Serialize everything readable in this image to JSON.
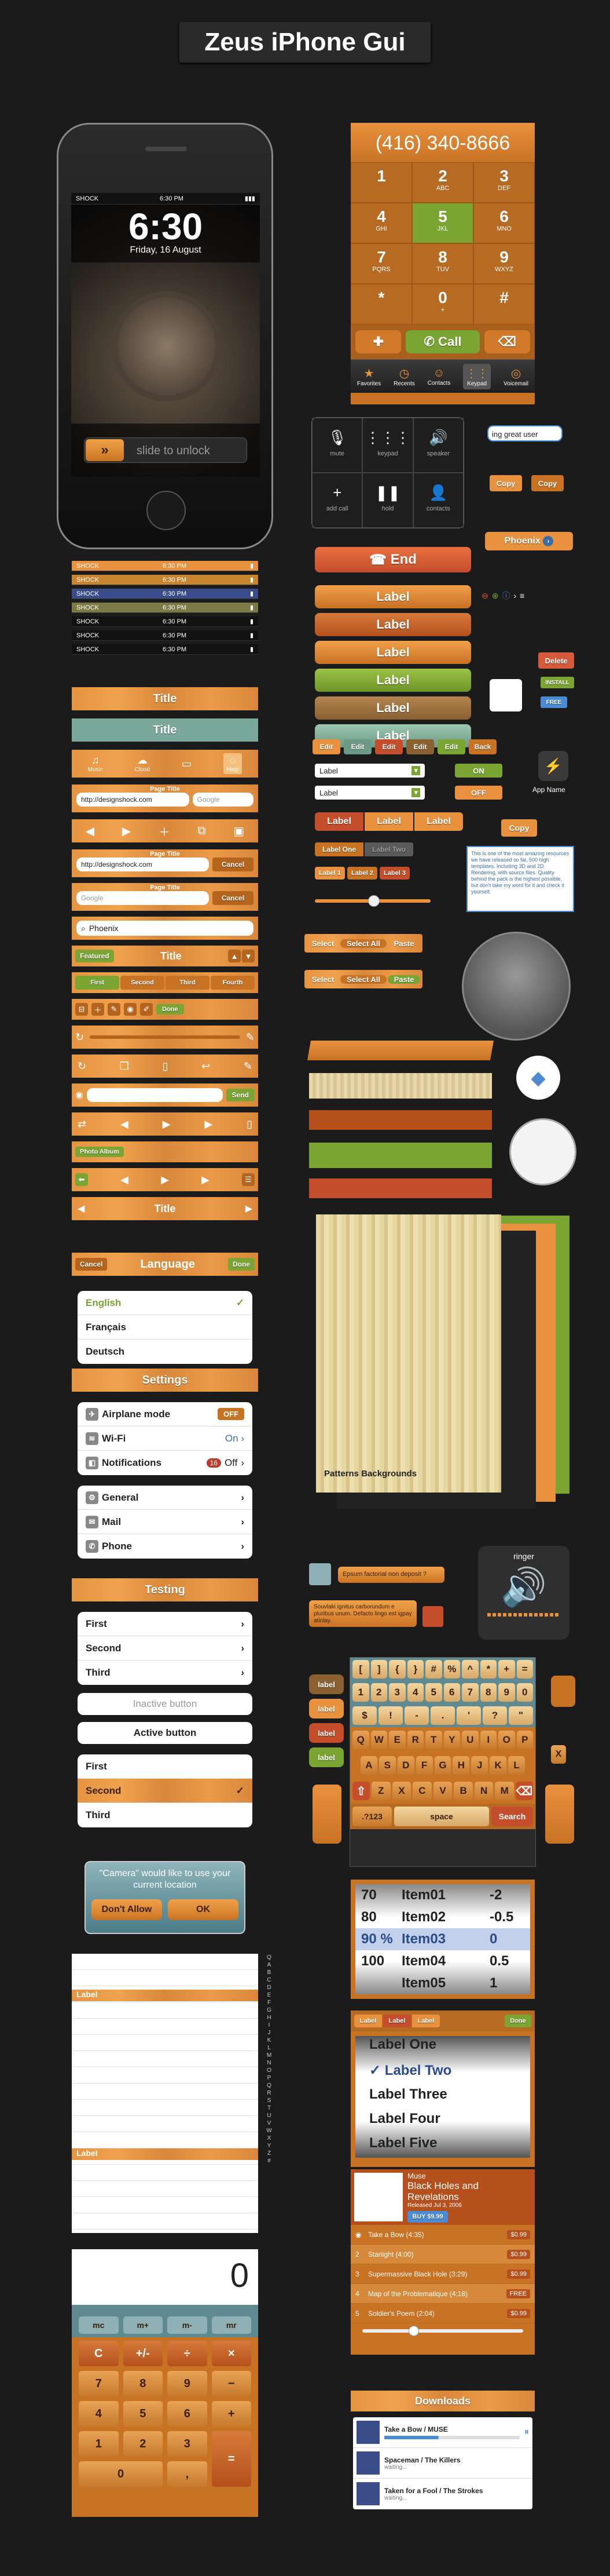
{
  "header": {
    "title": "Zeus iPhone Gui"
  },
  "phone": {
    "carrier": "SHOCK",
    "status_time": "6:30 PM",
    "time": "6:30",
    "date": "Friday, 16 August",
    "unlock": "slide to unlock"
  },
  "status_bars": [
    {
      "carrier": "SHOCK",
      "time": "6:30 PM"
    },
    {
      "carrier": "SHOCK",
      "time": "6:30 PM"
    },
    {
      "carrier": "SHOCK",
      "time": "6:30 PM"
    },
    {
      "carrier": "SHOCK",
      "time": "6:30 PM"
    },
    {
      "carrier": "SHOCK",
      "time": "6:30 PM"
    },
    {
      "carrier": "SHOCK",
      "time": "6:30 PM"
    },
    {
      "carrier": "SHOCK",
      "time": "6:30 PM"
    }
  ],
  "dialer": {
    "number": "(416) 340-8666",
    "keys": [
      {
        "n": "1",
        "l": ""
      },
      {
        "n": "2",
        "l": "ABC"
      },
      {
        "n": "3",
        "l": "DEF"
      },
      {
        "n": "4",
        "l": "GHI"
      },
      {
        "n": "5",
        "l": "JKL"
      },
      {
        "n": "6",
        "l": "MNO"
      },
      {
        "n": "7",
        "l": "PQRS"
      },
      {
        "n": "8",
        "l": "TUV"
      },
      {
        "n": "9",
        "l": "WXYZ"
      },
      {
        "n": "*",
        "l": ""
      },
      {
        "n": "0",
        "l": "+"
      },
      {
        "n": "#",
        "l": ""
      }
    ],
    "call": "Call",
    "tabs": [
      "Favorites",
      "Recents",
      "Contacts",
      "Keypad",
      "Voicemail"
    ]
  },
  "incall": {
    "buttons": [
      "mute",
      "keypad",
      "speaker",
      "add call",
      "hold",
      "contacts"
    ],
    "end": "End"
  },
  "tooltips": {
    "search": "ing great user",
    "copy1": "Copy",
    "copy2": "Copy",
    "bubble": "Phoenix"
  },
  "labels": [
    "Label",
    "Label",
    "Label",
    "Label",
    "Label",
    "Label"
  ],
  "small_buttons": {
    "edit": [
      "Edit",
      "Edit",
      "Edit",
      "Edit",
      "Edit"
    ],
    "back": "Back",
    "delete": "Delete",
    "install": "INSTALL",
    "free": "FREE",
    "on": "ON",
    "off": "OFF",
    "app_name": "App Name",
    "copy": "Copy",
    "label_one": "Label One",
    "label_two": "Label Two",
    "label_1": "Label 1",
    "label_2": "Label 2",
    "label_3": "Label 3"
  },
  "select_labels": [
    "Label",
    "Label"
  ],
  "segmented": [
    "Label",
    "Label",
    "Label"
  ],
  "lorem": "This is one of the most amazing resources we have released so far, 500 high templates. Including 3D and 2D Rendering, with source files. Quality behind the pack is the highest possible, but don't take my word for it and check it yourself.",
  "menus": {
    "first": [
      "Select",
      "Select All",
      "Paste"
    ],
    "second": [
      "Select",
      "Select All",
      "Paste"
    ]
  },
  "bars": {
    "title1": "Title",
    "title2": "Title",
    "tab_labels": [
      "Music",
      "Cloud",
      "",
      "Help"
    ],
    "page_title1": "Page Title",
    "url1": "http://designshock.com",
    "search_ph": "Google",
    "page_title2": "Page Title",
    "url2": "http://designshock.com",
    "cancel": "Cancel",
    "page_title3": "Page Title",
    "google": "Google",
    "cancel2": "Cancel",
    "search_val": "Phoenix",
    "featured": "Featured",
    "title3": "Title",
    "seg": [
      "First",
      "Second",
      "Third",
      "Fourth"
    ],
    "done": "Done",
    "send": "Send",
    "photo_album": "Photo Album",
    "title4": "Title"
  },
  "language": {
    "cancel": "Cancel",
    "title": "Language",
    "done": "Done",
    "items": [
      "English",
      "Français",
      "Deutsch"
    ]
  },
  "settings": {
    "title": "Settings",
    "group1": [
      {
        "label": "Airplane mode",
        "value": "OFF"
      },
      {
        "label": "Wi-Fi",
        "value": "On"
      },
      {
        "label": "Notifications",
        "value": "Off",
        "badge": "16"
      }
    ],
    "group2": [
      "General",
      "Mail",
      "Phone"
    ]
  },
  "testing": {
    "title": "Testing",
    "list1": [
      "First",
      "Second",
      "Third"
    ],
    "inactive": "Inactive button",
    "active": "Active button",
    "list2": [
      "First",
      "Second",
      "Third"
    ]
  },
  "alert": {
    "message": "\"Camera\" would like to use your current location",
    "dont": "Don't Allow",
    "ok": "OK"
  },
  "indexed": {
    "label1": "Label",
    "label2": "Label",
    "letters": [
      "Q",
      "A",
      "B",
      "C",
      "D",
      "E",
      "F",
      "G",
      "H",
      "I",
      "J",
      "K",
      "L",
      "M",
      "N",
      "O",
      "P",
      "Q",
      "R",
      "S",
      "T",
      "U",
      "V",
      "W",
      "X",
      "Y",
      "Z",
      "#"
    ]
  },
  "calculator": {
    "display": "0",
    "mem": [
      "mc",
      "m+",
      "m-",
      "mr"
    ],
    "rows": [
      [
        "C",
        "+/-",
        "÷",
        "×"
      ],
      [
        "7",
        "8",
        "9",
        "−"
      ],
      [
        "4",
        "5",
        "6",
        "+"
      ],
      [
        "1",
        "2",
        "3",
        "="
      ],
      [
        "0",
        ",",
        "",
        ""
      ]
    ]
  },
  "patterns": {
    "label": "Patterns Backgrounds"
  },
  "chat": {
    "bubble1": "Epsum factorial non deposit ?",
    "bubble2": "Souvlaki ignitus carborundum e pluribus unum. Defacto lingo est igpay atinlay."
  },
  "ringer": {
    "title": "ringer"
  },
  "keyboard": {
    "labels": [
      "label",
      "label",
      "label",
      "label"
    ],
    "row1": [
      "[",
      "]",
      "{",
      "}",
      "#",
      "%",
      "^",
      "*",
      "+",
      "="
    ],
    "row2": [
      "1",
      "2",
      "3",
      "4",
      "5",
      "6",
      "7",
      "8",
      "9",
      "0"
    ],
    "row3": [
      "$",
      "!",
      "-",
      ".",
      "'",
      "?",
      "\""
    ],
    "row4": [
      "Q",
      "W",
      "E",
      "R",
      "T",
      "Y",
      "U",
      "I",
      "O",
      "P"
    ],
    "row5": [
      "A",
      "S",
      "D",
      "F",
      "G",
      "H",
      "J",
      "K",
      "L"
    ],
    "row6": [
      "Z",
      "X",
      "C",
      "V",
      "B",
      "N",
      "M"
    ],
    "num": ".?123",
    "space": "space",
    "search": "Search",
    "x": "X"
  },
  "picker": {
    "rows": [
      {
        "a": "70",
        "b": "Item01",
        "c": "-2"
      },
      {
        "a": "80",
        "b": "Item02",
        "c": "-0.5"
      },
      {
        "a": "90 %",
        "b": "Item03",
        "c": "0"
      },
      {
        "a": "100",
        "b": "Item04",
        "c": "0.5"
      },
      {
        "a": "",
        "b": "Item05",
        "c": "1"
      }
    ]
  },
  "picker2": {
    "seg": [
      "Label",
      "Label",
      "Label"
    ],
    "done": "Done",
    "items": [
      "Label One",
      "Label Two",
      "Label Three",
      "Label Four",
      "Label Five"
    ]
  },
  "music": {
    "artist": "Muse",
    "album": "Black Holes and Revelations",
    "released": "Released Jul 3, 2006",
    "buy": "BUY $9.99",
    "tracks": [
      {
        "n": "",
        "title": "Take a Bow (4:35)",
        "price": "$0.99"
      },
      {
        "n": "2",
        "title": "Starlight (4:00)",
        "price": "$0.99"
      },
      {
        "n": "3",
        "title": "Supermassive Black Hole (3:29)",
        "price": "$0.99"
      },
      {
        "n": "4",
        "title": "Map of the Problematique (4:18)",
        "price": "FREE"
      },
      {
        "n": "5",
        "title": "Soldier's Poem (2:04)",
        "price": "$0.99"
      }
    ]
  },
  "downloads": {
    "title": "Downloads",
    "items": [
      {
        "title": "Take a Bow / MUSE",
        "status": ""
      },
      {
        "title": "Spaceman / The Killers",
        "status": "waiting..."
      },
      {
        "title": "Taken for a Fool / The Strokes",
        "status": "waiting..."
      }
    ]
  },
  "colors": {
    "accent": "#e8923f",
    "call_green": "#7aa532",
    "end_red": "#d65a3a"
  }
}
